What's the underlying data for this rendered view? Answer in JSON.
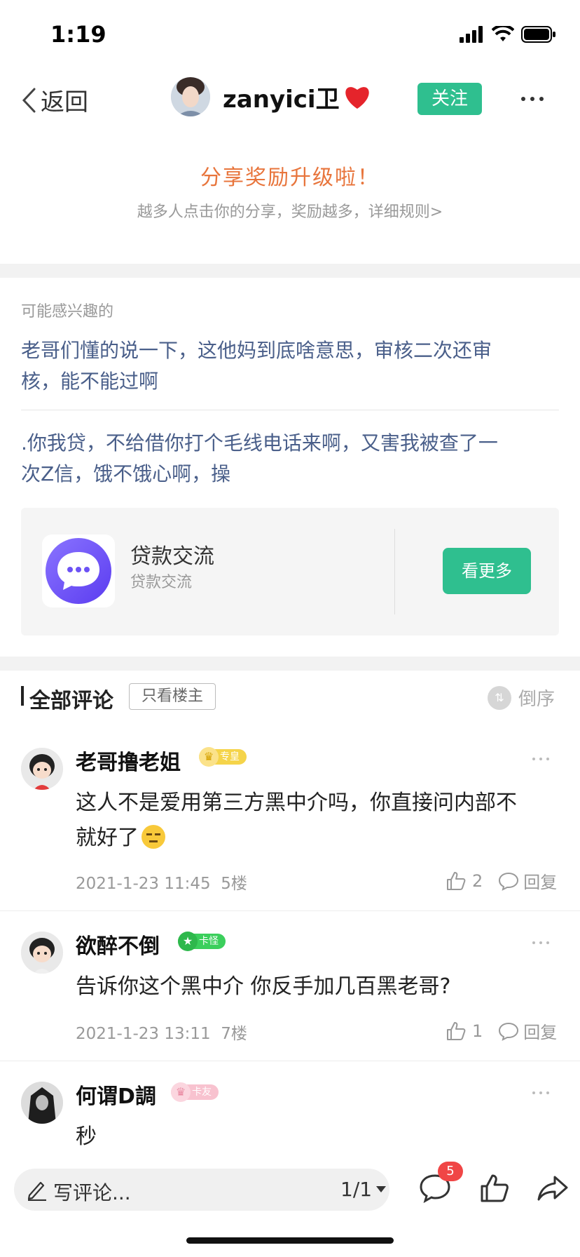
{
  "status": {
    "time": "1:19"
  },
  "nav": {
    "back_label": "返回",
    "author_name": "zanyici卫",
    "follow_label": "关注"
  },
  "share": {
    "title": "分享奖励升级啦！",
    "subtitle": "越多人点击你的分享，奖励越多，详细规则>"
  },
  "interests": {
    "title": "可能感兴趣的",
    "items": [
      {
        "line1": "老哥们懂的说一下，这他妈到底啥意思，审核二次还审",
        "line2": "核，能不能过啊"
      },
      {
        "line1": ".你我贷，不给借你打个毛线电话来啊，又害我被查了一",
        "line2": "次Z信，饿不饿心啊，操"
      }
    ],
    "card": {
      "title": "贷款交流",
      "subtitle": "贷款交流",
      "button": "看更多"
    }
  },
  "comments_header": {
    "title": "全部评论",
    "only_op": "只看楼主",
    "sort": "倒序"
  },
  "comments": [
    {
      "name": "老哥撸老姐",
      "badge": "专皇",
      "badge_color": "#f5c93a",
      "line1": "这人不是爱用第三方黑中介吗，你直接问内部不",
      "line2": "就好了",
      "time": "2021-1-23 11:45",
      "floor": "5楼",
      "likes": "2",
      "reply": "回复"
    },
    {
      "name": "欲醉不倒",
      "badge": "卡怪",
      "badge_color": "#39c95a",
      "line1": "告诉你这个黑中介 你反手加几百黑老哥?",
      "time": "2021-1-23 13:11",
      "floor": "7楼",
      "likes": "1",
      "reply": "回复"
    },
    {
      "name": "何谓D調",
      "badge": "卡友",
      "badge_color": "#f7b4c4",
      "line1": "秒"
    }
  ],
  "bottom_bar": {
    "placeholder": "写评论...",
    "page": "1/1",
    "comment_count": "5"
  },
  "colors": {
    "accent_green": "#2fbf8f",
    "link_blue": "#4a5f8a",
    "share_orange": "#e8753c",
    "badge_red": "#f04646"
  },
  "icons": [
    "back-chevron-icon",
    "heart-icon",
    "more-icon",
    "chat-icon",
    "sort-icon",
    "thumb-up-icon",
    "comment-icon",
    "pen-icon",
    "share-icon"
  ]
}
